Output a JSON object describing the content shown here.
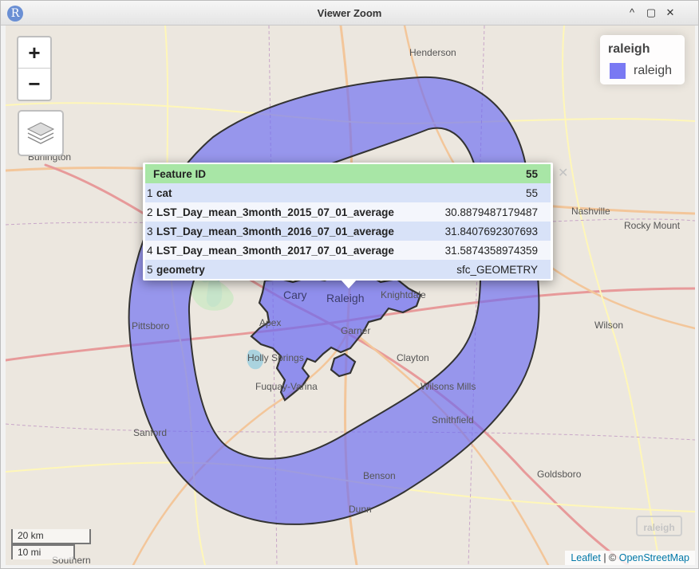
{
  "window": {
    "title": "Viewer Zoom",
    "app_icon_letter": "R",
    "controls": {
      "minimize": "^",
      "restore": "▢",
      "close": "✕"
    }
  },
  "map": {
    "towns": [
      {
        "label": "Henderson",
        "type": "town"
      },
      {
        "label": "Burlington",
        "type": "town"
      },
      {
        "label": "Nashville",
        "type": "town"
      },
      {
        "label": "Rocky Mount",
        "type": "town"
      },
      {
        "label": "Pittsboro",
        "type": "town"
      },
      {
        "label": "Cary",
        "type": "city"
      },
      {
        "label": "Raleigh",
        "type": "city"
      },
      {
        "label": "Knightdale",
        "type": "town"
      },
      {
        "label": "Apex",
        "type": "town"
      },
      {
        "label": "Garner",
        "type": "town"
      },
      {
        "label": "Wilson",
        "type": "town"
      },
      {
        "label": "Holly Springs",
        "type": "town"
      },
      {
        "label": "Clayton",
        "type": "town"
      },
      {
        "label": "Fuquay-Varina",
        "type": "town"
      },
      {
        "label": "Wilsons Mills",
        "type": "town"
      },
      {
        "label": "Smithfield",
        "type": "town"
      },
      {
        "label": "Sanford",
        "type": "town"
      },
      {
        "label": "Benson",
        "type": "town"
      },
      {
        "label": "Goldsboro",
        "type": "town"
      },
      {
        "label": "Dunn",
        "type": "town"
      },
      {
        "label": "Southern",
        "type": "town"
      }
    ],
    "polygon_fill": "#6a6af2",
    "polygon_stroke": "#333333"
  },
  "controls": {
    "zoom_in": "+",
    "zoom_out": "−",
    "layers_icon": "layers-icon"
  },
  "legend": {
    "title": "raleigh",
    "items": [
      {
        "label": "raleigh",
        "color": "#6a6af2"
      }
    ]
  },
  "popup": {
    "header": {
      "label": "Feature ID",
      "value": "55"
    },
    "rows": [
      {
        "index": "1",
        "key": "cat",
        "value": "55"
      },
      {
        "index": "2",
        "key": "LST_Day_mean_3month_2015_07_01_average",
        "value": "30.8879487179487"
      },
      {
        "index": "3",
        "key": "LST_Day_mean_3month_2016_07_01_average",
        "value": "31.8407692307693"
      },
      {
        "index": "4",
        "key": "LST_Day_mean_3month_2017_07_01_average",
        "value": "31.5874358974359"
      },
      {
        "index": "5",
        "key": "geometry",
        "value": "sfc_GEOMETRY"
      }
    ],
    "close": "✕"
  },
  "scale": {
    "km": "20 km",
    "mi": "10 mi"
  },
  "attribution": {
    "leaflet": "Leaflet",
    "separator": " | © ",
    "osm": "OpenStreetMap"
  },
  "watermark": "raleigh"
}
